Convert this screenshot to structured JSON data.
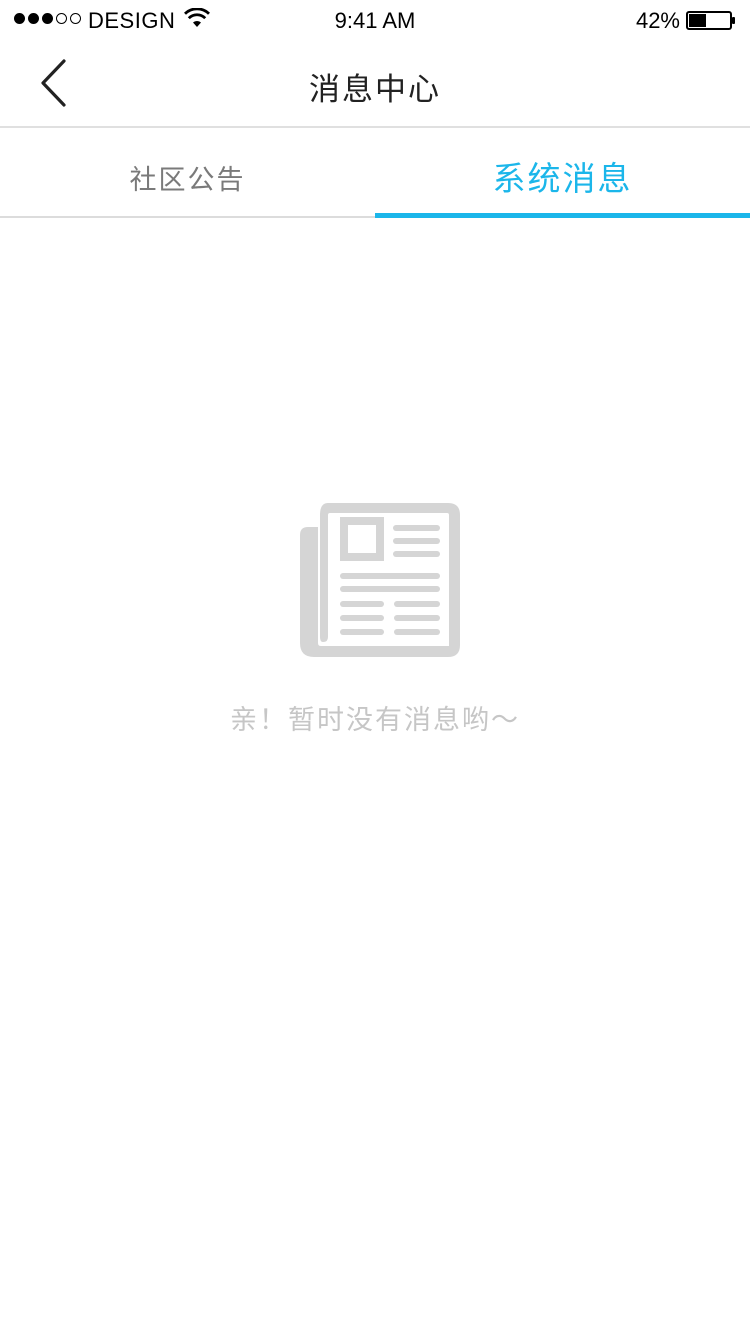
{
  "status_bar": {
    "carrier": "DESIGN",
    "time": "9:41 AM",
    "battery_percent": "42%",
    "battery_level": 0.42,
    "signal_strength": 3,
    "signal_max": 5,
    "wifi_icon": "wifi-icon",
    "battery_icon": "battery-icon"
  },
  "nav": {
    "back_icon": "chevron-left-icon",
    "title": "消息中心"
  },
  "tabs": [
    {
      "label": "社区公告",
      "selected": false
    },
    {
      "label": "系统消息",
      "selected": true
    }
  ],
  "colors": {
    "accent": "#1bb6ea",
    "tab_inactive": "#7a7a7a",
    "empty_icon": "#d5d5d5",
    "empty_text": "#c6c6c6",
    "divider": "#e0e0e0"
  },
  "empty_state": {
    "icon": "newspaper-icon",
    "message": "亲！暂时没有消息哟～"
  }
}
